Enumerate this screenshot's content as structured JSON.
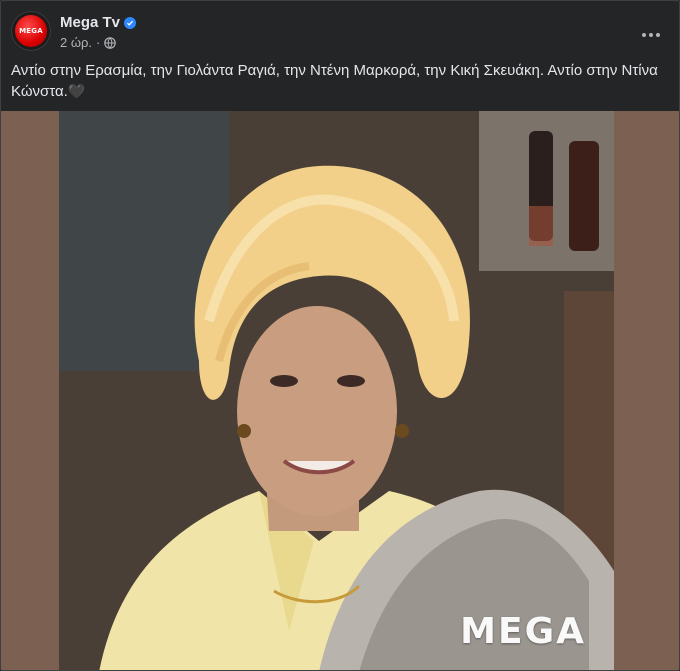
{
  "post": {
    "page_name": "Mega Tv",
    "time": "2 ώρ.",
    "separator": "·",
    "caption": "Αντίο στην Ερασμία, την Γιολάντα Ραγιά, την Ντένη Μαρκορά, την Κική Σκευάκη. Αντίο στην Ντίνα Κώνστα.",
    "caption_emoji": "🖤",
    "avatar_text": "MEGA",
    "watermark": "MEGA"
  },
  "icons": {
    "verified": "verified-badge-icon",
    "audience": "globe-icon",
    "more": "more-options-icon"
  },
  "colors": {
    "background": "#242526",
    "text": "#e4e6eb",
    "secondary_text": "#b0b3b8",
    "verified_blue": "#2d88ff",
    "brand_red": "#d90000"
  }
}
